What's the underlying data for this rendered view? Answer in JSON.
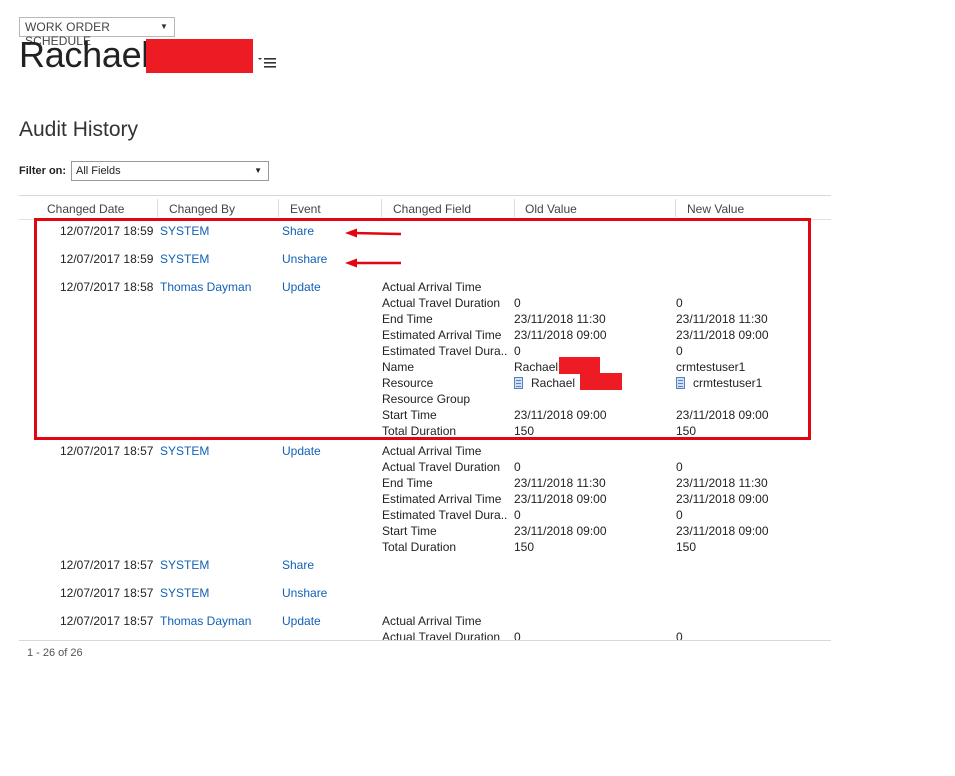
{
  "header": {
    "form_selector": "WORK ORDER SCHEDULE",
    "record_name": "Rachael"
  },
  "section": {
    "title": "Audit History"
  },
  "filter": {
    "label": "Filter on:",
    "selected": "All Fields"
  },
  "columns": [
    "Changed Date",
    "Changed By",
    "Event",
    "Changed Field",
    "Old Value",
    "New Value"
  ],
  "rows": [
    {
      "date": "12/07/2017 18:59",
      "by": "SYSTEM",
      "event": "Share"
    },
    {
      "date": "12/07/2017 18:59",
      "by": "SYSTEM",
      "event": "Unshare"
    },
    {
      "date": "12/07/2017 18:58",
      "by": "Thomas Dayman",
      "event": "Update",
      "fields": [
        {
          "field": "Actual Arrival Time",
          "old": "",
          "new": ""
        },
        {
          "field": "Actual Travel Duration",
          "old": "0",
          "new": "0"
        },
        {
          "field": "End Time",
          "old": "23/11/2018 11:30",
          "new": "23/11/2018 11:30"
        },
        {
          "field": "Estimated Arrival Time",
          "old": "23/11/2018 09:00",
          "new": "23/11/2018 09:00"
        },
        {
          "field": "Estimated Travel Dura...",
          "old": "0",
          "new": "0"
        },
        {
          "field": "Name",
          "old": "Rachael",
          "new": "crmtestuser1"
        },
        {
          "field": "Resource",
          "old": "Rachael",
          "new": "crmtestuser1"
        },
        {
          "field": "Resource Group",
          "old": "",
          "new": ""
        },
        {
          "field": "Start Time",
          "old": "23/11/2018 09:00",
          "new": "23/11/2018 09:00"
        },
        {
          "field": "Total Duration",
          "old": "150",
          "new": "150"
        }
      ]
    },
    {
      "date": "12/07/2017 18:57",
      "by": "SYSTEM",
      "event": "Update",
      "fields": [
        {
          "field": "Actual Arrival Time",
          "old": "",
          "new": ""
        },
        {
          "field": "Actual Travel Duration",
          "old": "0",
          "new": "0"
        },
        {
          "field": "End Time",
          "old": "23/11/2018 11:30",
          "new": "23/11/2018 11:30"
        },
        {
          "field": "Estimated Arrival Time",
          "old": "23/11/2018 09:00",
          "new": "23/11/2018 09:00"
        },
        {
          "field": "Estimated Travel Dura...",
          "old": "0",
          "new": "0"
        },
        {
          "field": "Start Time",
          "old": "23/11/2018 09:00",
          "new": "23/11/2018 09:00"
        },
        {
          "field": "Total Duration",
          "old": "150",
          "new": "150"
        }
      ]
    },
    {
      "date": "12/07/2017 18:57",
      "by": "SYSTEM",
      "event": "Share"
    },
    {
      "date": "12/07/2017 18:57",
      "by": "SYSTEM",
      "event": "Unshare"
    },
    {
      "date": "12/07/2017 18:57",
      "by": "Thomas Dayman",
      "event": "Update",
      "fields": [
        {
          "field": "Actual Arrival Time",
          "old": "",
          "new": ""
        },
        {
          "field": "Actual Travel Duration",
          "old": "0",
          "new": "0"
        }
      ]
    }
  ],
  "pager": {
    "text": "1 - 26 of 26"
  },
  "colors": {
    "link": "#1160b7",
    "annotation": "#e3050f",
    "redaction": "#ed1c24"
  }
}
